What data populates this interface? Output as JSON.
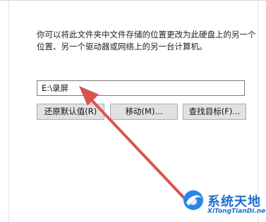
{
  "dialog": {
    "description_line1": "你可以将此文件夹中文件存储的位置更改为此硬盘上的另一个",
    "description_line2": "位置、另一个驱动器或网络上的另一台计算机。",
    "path_value": "E:\\录屏",
    "buttons": {
      "restore_default": "还原默认值(R)",
      "move": "移动(M)...",
      "find_target": "查找目标(F)..."
    }
  },
  "annotation": {
    "arrow_color": "#d9534f"
  },
  "watermark": {
    "title": "系统天地",
    "url": "XiTongTianDi.net",
    "color": "#1a6fd0"
  }
}
